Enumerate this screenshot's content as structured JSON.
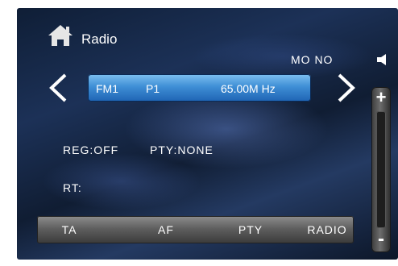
{
  "header": {
    "title": "Radio",
    "home_icon": "home-icon",
    "stereo_mode": "MO NO",
    "speaker_icon": "speaker-icon"
  },
  "tuner": {
    "band": "FM1",
    "preset": "P1",
    "frequency": "65.00M Hz",
    "prev_icon": "chevron-left-icon",
    "next_icon": "chevron-right-icon"
  },
  "status": {
    "reg": "REG:OFF",
    "pty": "PTY:NONE",
    "rt": "RT:"
  },
  "bottom_bar": {
    "ta_label": "TA",
    "af_label": "AF",
    "pty_label": "PTY",
    "radio_label": "RADIO"
  },
  "volume": {
    "plus_label": "+",
    "minus_label": "-"
  },
  "colors": {
    "accent_blue": "#3f8fd6",
    "bar_gray": "#5f5f5f",
    "background_dark": "#1c3157"
  }
}
